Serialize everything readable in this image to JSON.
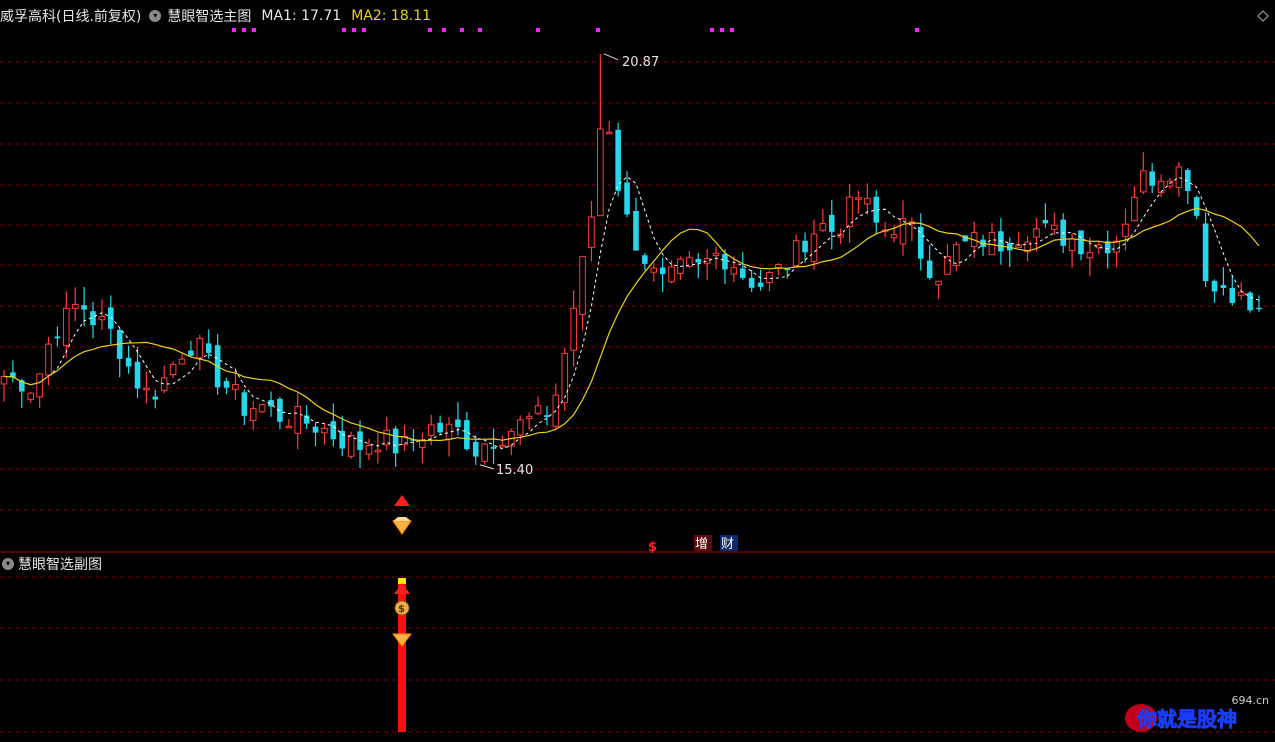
{
  "header": {
    "stock_name": "威孚高科",
    "period": "(日线.前复权)",
    "indicator": "慧眼智选主图",
    "ma1_label": "MA1: 17.71",
    "ma2_label": "MA2: 18.11"
  },
  "sub_header": {
    "indicator": "慧眼智选副图"
  },
  "annotations": {
    "high": "20.87",
    "low": "15.40"
  },
  "signals": {
    "dollar": "$",
    "zeng": "增",
    "cai": "财"
  },
  "logo": {
    "site": "694.cn",
    "text": "你就是股神"
  },
  "colors": {
    "up": "#ff3b3b",
    "down": "#27d7e9",
    "ma1": "#ffffff",
    "ma2": "#e8d21a",
    "marker": "#ff22ff",
    "grid": "#7a0000",
    "highlight": "#ffe800"
  },
  "chart_data": {
    "type": "candlestick",
    "y_axis_range": [
      14.4,
      21.4
    ],
    "high_value": 20.87,
    "low_value": 15.4
  }
}
